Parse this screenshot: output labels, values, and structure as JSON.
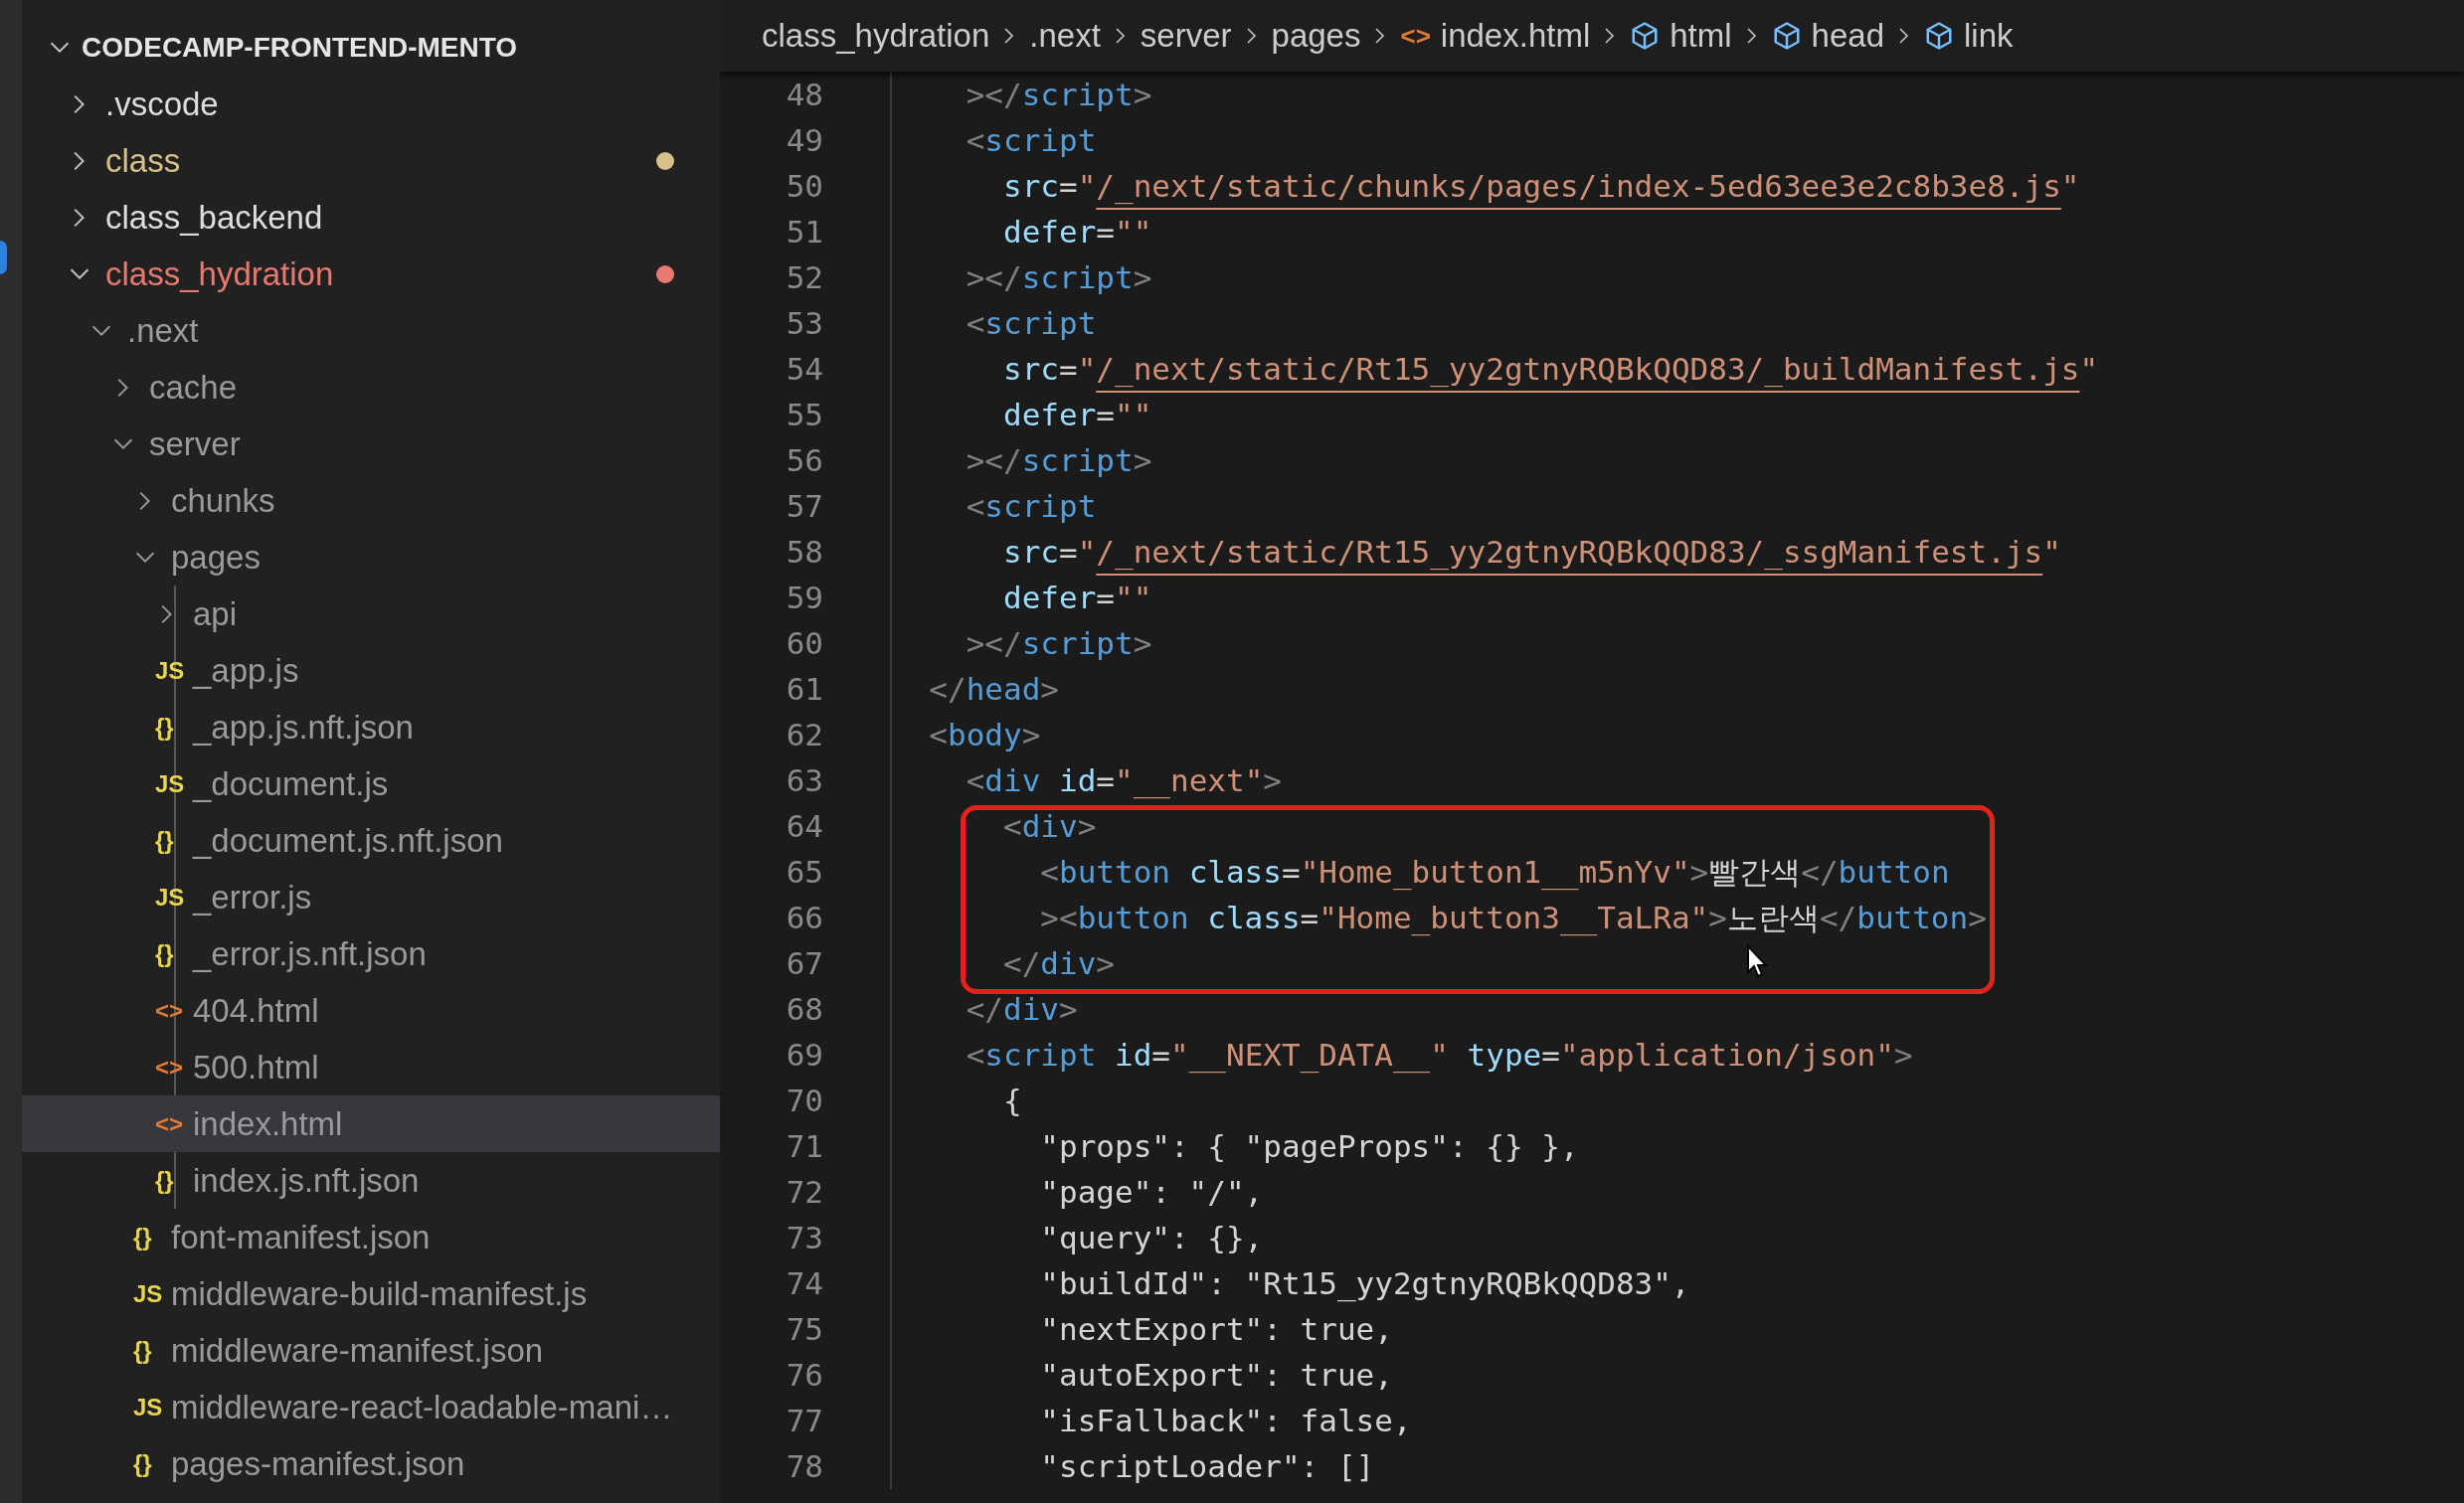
{
  "sidebar": {
    "workspace": {
      "title": "CODECAMP-FRONTEND-MENTO",
      "expanded": true
    },
    "items": [
      {
        "label": ".vscode",
        "kind": "folder",
        "expanded": false,
        "selected": false,
        "dimmed": false
      },
      {
        "label": "class",
        "kind": "folder",
        "expanded": false,
        "selected": false,
        "dimmed": false,
        "color": "#d8c08a"
      },
      {
        "label": "class_backend",
        "kind": "folder",
        "expanded": false,
        "selected": false,
        "dimmed": false
      },
      {
        "label": "class_hydration",
        "kind": "folder",
        "expanded": true,
        "selected": false,
        "dimmed": false,
        "color": "#e9786f",
        "children": [
          {
            "label": ".next",
            "kind": "folder",
            "expanded": true,
            "selected": false,
            "dimmed": true,
            "children": [
              {
                "label": "cache",
                "kind": "folder",
                "expanded": false,
                "selected": false,
                "dimmed": true
              },
              {
                "label": "server",
                "kind": "folder",
                "expanded": true,
                "selected": false,
                "dimmed": true,
                "children": [
                  {
                    "label": "chunks",
                    "kind": "folder",
                    "expanded": false,
                    "selected": false,
                    "dimmed": true
                  },
                  {
                    "label": "pages",
                    "kind": "folder",
                    "expanded": true,
                    "selected": false,
                    "dimmed": true,
                    "children": [
                      {
                        "label": "api",
                        "kind": "folder",
                        "expanded": false,
                        "selected": false,
                        "dimmed": true
                      },
                      {
                        "label": "_app.js",
                        "kind": "js",
                        "icon": "JS",
                        "selected": false,
                        "dimmed": true
                      },
                      {
                        "label": "_app.js.nft.json",
                        "kind": "json",
                        "icon": "{}",
                        "selected": false,
                        "dimmed": true
                      },
                      {
                        "label": "_document.js",
                        "kind": "js",
                        "icon": "JS",
                        "selected": false,
                        "dimmed": true
                      },
                      {
                        "label": "_document.js.nft.json",
                        "kind": "json",
                        "icon": "{}",
                        "selected": false,
                        "dimmed": true
                      },
                      {
                        "label": "_error.js",
                        "kind": "js",
                        "icon": "JS",
                        "selected": false,
                        "dimmed": true
                      },
                      {
                        "label": "_error.js.nft.json",
                        "kind": "json",
                        "icon": "{}",
                        "selected": false,
                        "dimmed": true
                      },
                      {
                        "label": "404.html",
                        "kind": "html",
                        "icon": "<>",
                        "selected": false,
                        "dimmed": true
                      },
                      {
                        "label": "500.html",
                        "kind": "html",
                        "icon": "<>",
                        "selected": false,
                        "dimmed": true
                      },
                      {
                        "label": "index.html",
                        "kind": "html",
                        "icon": "<>",
                        "selected": true,
                        "dimmed": true
                      },
                      {
                        "label": "index.js.nft.json",
                        "kind": "json",
                        "icon": "{}",
                        "selected": false,
                        "dimmed": true
                      }
                    ]
                  },
                  {
                    "label": "font-manifest.json",
                    "kind": "json",
                    "icon": "{}",
                    "selected": false,
                    "dimmed": true
                  },
                  {
                    "label": "middleware-build-manifest.js",
                    "kind": "js",
                    "icon": "JS",
                    "selected": false,
                    "dimmed": true
                  },
                  {
                    "label": "middleware-manifest.json",
                    "kind": "json",
                    "icon": "{}",
                    "selected": false,
                    "dimmed": true
                  },
                  {
                    "label": "middleware-react-loadable-mani…",
                    "kind": "js",
                    "icon": "JS",
                    "selected": false,
                    "dimmed": true
                  },
                  {
                    "label": "pages-manifest.json",
                    "kind": "json",
                    "icon": "{}",
                    "selected": false,
                    "dimmed": true
                  }
                ]
              }
            ]
          }
        ]
      }
    ]
  },
  "breadcrumb": [
    {
      "label": "class_hydration",
      "kind": "folder"
    },
    {
      "label": ".next",
      "kind": "folder"
    },
    {
      "label": "server",
      "kind": "folder"
    },
    {
      "label": "pages",
      "kind": "folder"
    },
    {
      "label": "index.html",
      "kind": "file",
      "icon": "<>"
    },
    {
      "label": "html",
      "kind": "element"
    },
    {
      "label": "head",
      "kind": "element"
    },
    {
      "label": "link",
      "kind": "element"
    }
  ],
  "editor": {
    "lines": [
      {
        "number": "48",
        "highlighted": false,
        "tokens": [
          {
            "kind": "punct",
            "text": "    ></"
          },
          {
            "kind": "tag",
            "text": "script"
          },
          {
            "kind": "punct",
            "text": ">"
          }
        ]
      },
      {
        "number": "49",
        "highlighted": false,
        "tokens": [
          {
            "kind": "punct",
            "text": "    <"
          },
          {
            "kind": "tag",
            "text": "script"
          }
        ]
      },
      {
        "number": "50",
        "highlighted": false,
        "tokens": [
          {
            "kind": "attr",
            "text": "      src"
          },
          {
            "kind": "text",
            "text": "="
          },
          {
            "kind": "string",
            "text": "\""
          },
          {
            "kind": "url",
            "text": "/_next/static/chunks/pages/index-5ed63ee3e2c8b3e8.js"
          },
          {
            "kind": "string",
            "text": "\""
          }
        ]
      },
      {
        "number": "51",
        "highlighted": false,
        "tokens": [
          {
            "kind": "attr",
            "text": "      defer"
          },
          {
            "kind": "text",
            "text": "="
          },
          {
            "kind": "string",
            "text": "\"\""
          }
        ]
      },
      {
        "number": "52",
        "highlighted": false,
        "tokens": [
          {
            "kind": "punct",
            "text": "    ></"
          },
          {
            "kind": "tag",
            "text": "script"
          },
          {
            "kind": "punct",
            "text": ">"
          }
        ]
      },
      {
        "number": "53",
        "highlighted": false,
        "tokens": [
          {
            "kind": "punct",
            "text": "    <"
          },
          {
            "kind": "tag",
            "text": "script"
          }
        ]
      },
      {
        "number": "54",
        "highlighted": false,
        "tokens": [
          {
            "kind": "attr",
            "text": "      src"
          },
          {
            "kind": "text",
            "text": "="
          },
          {
            "kind": "string",
            "text": "\""
          },
          {
            "kind": "url",
            "text": "/_next/static/Rt15_yy2gtnyRQBkQQD83/_buildManifest.js"
          },
          {
            "kind": "string",
            "text": "\""
          }
        ]
      },
      {
        "number": "55",
        "highlighted": false,
        "tokens": [
          {
            "kind": "attr",
            "text": "      defer"
          },
          {
            "kind": "text",
            "text": "="
          },
          {
            "kind": "string",
            "text": "\"\""
          }
        ]
      },
      {
        "number": "56",
        "highlighted": false,
        "tokens": [
          {
            "kind": "punct",
            "text": "    ></"
          },
          {
            "kind": "tag",
            "text": "script"
          },
          {
            "kind": "punct",
            "text": ">"
          }
        ]
      },
      {
        "number": "57",
        "highlighted": false,
        "tokens": [
          {
            "kind": "punct",
            "text": "    <"
          },
          {
            "kind": "tag",
            "text": "script"
          }
        ]
      },
      {
        "number": "58",
        "highlighted": false,
        "tokens": [
          {
            "kind": "attr",
            "text": "      src"
          },
          {
            "kind": "text",
            "text": "="
          },
          {
            "kind": "string",
            "text": "\""
          },
          {
            "kind": "url",
            "text": "/_next/static/Rt15_yy2gtnyRQBkQQD83/_ssgManifest.js"
          },
          {
            "kind": "string",
            "text": "\""
          }
        ]
      },
      {
        "number": "59",
        "highlighted": false,
        "tokens": [
          {
            "kind": "attr",
            "text": "      defer"
          },
          {
            "kind": "text",
            "text": "="
          },
          {
            "kind": "string",
            "text": "\"\""
          }
        ]
      },
      {
        "number": "60",
        "highlighted": false,
        "tokens": [
          {
            "kind": "punct",
            "text": "    ></"
          },
          {
            "kind": "tag",
            "text": "script"
          },
          {
            "kind": "punct",
            "text": ">"
          }
        ]
      },
      {
        "number": "61",
        "highlighted": false,
        "tokens": [
          {
            "kind": "punct",
            "text": "  </"
          },
          {
            "kind": "tag",
            "text": "head"
          },
          {
            "kind": "punct",
            "text": ">"
          }
        ]
      },
      {
        "number": "62",
        "highlighted": false,
        "tokens": [
          {
            "kind": "punct",
            "text": "  <"
          },
          {
            "kind": "tag",
            "text": "body"
          },
          {
            "kind": "punct",
            "text": ">"
          }
        ]
      },
      {
        "number": "63",
        "highlighted": false,
        "tokens": [
          {
            "kind": "punct",
            "text": "    <"
          },
          {
            "kind": "tag",
            "text": "div"
          },
          {
            "kind": "attr",
            "text": " id"
          },
          {
            "kind": "text",
            "text": "="
          },
          {
            "kind": "string",
            "text": "\"__next\""
          },
          {
            "kind": "punct",
            "text": ">"
          }
        ]
      },
      {
        "number": "64",
        "highlighted": true,
        "tokens": [
          {
            "kind": "punct",
            "text": "      <"
          },
          {
            "kind": "tag",
            "text": "div"
          },
          {
            "kind": "punct",
            "text": ">"
          }
        ]
      },
      {
        "number": "65",
        "highlighted": true,
        "tokens": [
          {
            "kind": "punct",
            "text": "        <"
          },
          {
            "kind": "tag",
            "text": "button"
          },
          {
            "kind": "attr",
            "text": " class"
          },
          {
            "kind": "text",
            "text": "="
          },
          {
            "kind": "string",
            "text": "\"Home_button1__m5nYv\""
          },
          {
            "kind": "punct",
            "text": ">"
          },
          {
            "kind": "text",
            "text": "빨간색"
          },
          {
            "kind": "punct",
            "text": "</"
          },
          {
            "kind": "tag",
            "text": "button"
          }
        ]
      },
      {
        "number": "66",
        "highlighted": true,
        "tokens": [
          {
            "kind": "punct",
            "text": "        ><"
          },
          {
            "kind": "tag",
            "text": "button"
          },
          {
            "kind": "attr",
            "text": " class"
          },
          {
            "kind": "text",
            "text": "="
          },
          {
            "kind": "string",
            "text": "\"Home_button3__TaLRa\""
          },
          {
            "kind": "punct",
            "text": ">"
          },
          {
            "kind": "text",
            "text": "노란색"
          },
          {
            "kind": "punct",
            "text": "</"
          },
          {
            "kind": "tag",
            "text": "button"
          },
          {
            "kind": "punct",
            "text": ">"
          }
        ]
      },
      {
        "number": "67",
        "highlighted": true,
        "tokens": [
          {
            "kind": "punct",
            "text": "      </"
          },
          {
            "kind": "tag",
            "text": "div"
          },
          {
            "kind": "punct",
            "text": ">"
          }
        ]
      },
      {
        "number": "68",
        "highlighted": false,
        "tokens": [
          {
            "kind": "punct",
            "text": "    </"
          },
          {
            "kind": "tag",
            "text": "div"
          },
          {
            "kind": "punct",
            "text": ">"
          }
        ]
      },
      {
        "number": "69",
        "highlighted": false,
        "tokens": [
          {
            "kind": "punct",
            "text": "    <"
          },
          {
            "kind": "tag",
            "text": "script"
          },
          {
            "kind": "attr",
            "text": " id"
          },
          {
            "kind": "text",
            "text": "="
          },
          {
            "kind": "string",
            "text": "\"__NEXT_DATA__\""
          },
          {
            "kind": "attr",
            "text": " type"
          },
          {
            "kind": "text",
            "text": "="
          },
          {
            "kind": "string",
            "text": "\"application/json\""
          },
          {
            "kind": "punct",
            "text": ">"
          }
        ]
      },
      {
        "number": "70",
        "highlighted": false,
        "tokens": [
          {
            "kind": "text",
            "text": "      {"
          }
        ]
      },
      {
        "number": "71",
        "highlighted": false,
        "tokens": [
          {
            "kind": "text",
            "text": "        \"props\": { \"pageProps\": {} },"
          }
        ]
      },
      {
        "number": "72",
        "highlighted": false,
        "tokens": [
          {
            "kind": "text",
            "text": "        \"page\": \"/\","
          }
        ]
      },
      {
        "number": "73",
        "highlighted": false,
        "tokens": [
          {
            "kind": "text",
            "text": "        \"query\": {},"
          }
        ]
      },
      {
        "number": "74",
        "highlighted": false,
        "tokens": [
          {
            "kind": "text",
            "text": "        \"buildId\": \"Rt15_yy2gtnyRQBkQQD83\","
          }
        ]
      },
      {
        "number": "75",
        "highlighted": false,
        "tokens": [
          {
            "kind": "text",
            "text": "        \"nextExport\": true,"
          }
        ]
      },
      {
        "number": "76",
        "highlighted": false,
        "tokens": [
          {
            "kind": "text",
            "text": "        \"autoExport\": true,"
          }
        ]
      },
      {
        "number": "77",
        "highlighted": false,
        "tokens": [
          {
            "kind": "text",
            "text": "        \"isFallback\": false,"
          }
        ]
      },
      {
        "number": "78",
        "highlighted": false,
        "tokens": [
          {
            "kind": "text",
            "text": "        \"scriptLoader\": []"
          }
        ]
      }
    ]
  }
}
